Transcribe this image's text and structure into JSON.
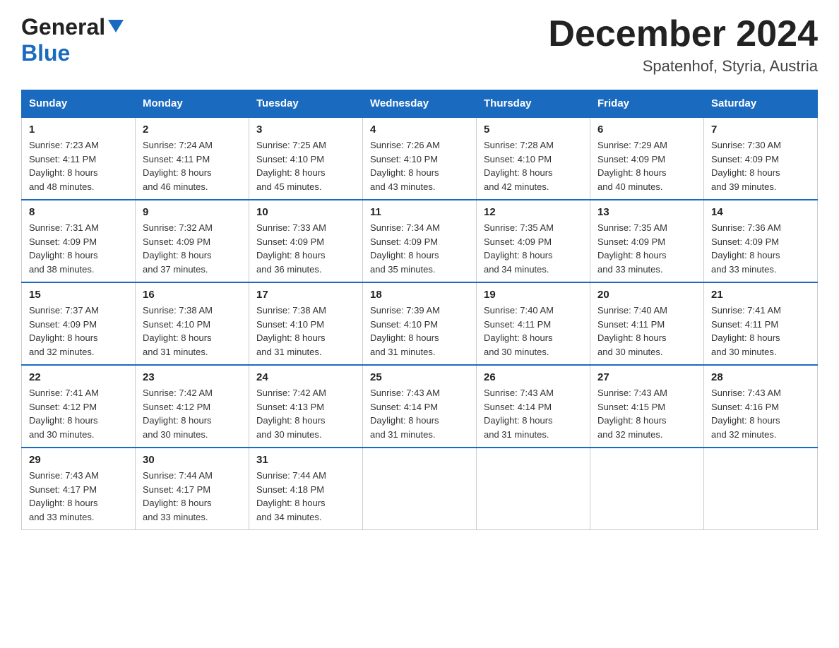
{
  "header": {
    "logo_general": "General",
    "logo_blue": "Blue",
    "month_year": "December 2024",
    "location": "Spatenhof, Styria, Austria"
  },
  "days_of_week": [
    "Sunday",
    "Monday",
    "Tuesday",
    "Wednesday",
    "Thursday",
    "Friday",
    "Saturday"
  ],
  "weeks": [
    [
      {
        "day": "1",
        "sunrise": "Sunrise: 7:23 AM",
        "sunset": "Sunset: 4:11 PM",
        "daylight": "Daylight: 8 hours",
        "daylight2": "and 48 minutes."
      },
      {
        "day": "2",
        "sunrise": "Sunrise: 7:24 AM",
        "sunset": "Sunset: 4:11 PM",
        "daylight": "Daylight: 8 hours",
        "daylight2": "and 46 minutes."
      },
      {
        "day": "3",
        "sunrise": "Sunrise: 7:25 AM",
        "sunset": "Sunset: 4:10 PM",
        "daylight": "Daylight: 8 hours",
        "daylight2": "and 45 minutes."
      },
      {
        "day": "4",
        "sunrise": "Sunrise: 7:26 AM",
        "sunset": "Sunset: 4:10 PM",
        "daylight": "Daylight: 8 hours",
        "daylight2": "and 43 minutes."
      },
      {
        "day": "5",
        "sunrise": "Sunrise: 7:28 AM",
        "sunset": "Sunset: 4:10 PM",
        "daylight": "Daylight: 8 hours",
        "daylight2": "and 42 minutes."
      },
      {
        "day": "6",
        "sunrise": "Sunrise: 7:29 AM",
        "sunset": "Sunset: 4:09 PM",
        "daylight": "Daylight: 8 hours",
        "daylight2": "and 40 minutes."
      },
      {
        "day": "7",
        "sunrise": "Sunrise: 7:30 AM",
        "sunset": "Sunset: 4:09 PM",
        "daylight": "Daylight: 8 hours",
        "daylight2": "and 39 minutes."
      }
    ],
    [
      {
        "day": "8",
        "sunrise": "Sunrise: 7:31 AM",
        "sunset": "Sunset: 4:09 PM",
        "daylight": "Daylight: 8 hours",
        "daylight2": "and 38 minutes."
      },
      {
        "day": "9",
        "sunrise": "Sunrise: 7:32 AM",
        "sunset": "Sunset: 4:09 PM",
        "daylight": "Daylight: 8 hours",
        "daylight2": "and 37 minutes."
      },
      {
        "day": "10",
        "sunrise": "Sunrise: 7:33 AM",
        "sunset": "Sunset: 4:09 PM",
        "daylight": "Daylight: 8 hours",
        "daylight2": "and 36 minutes."
      },
      {
        "day": "11",
        "sunrise": "Sunrise: 7:34 AM",
        "sunset": "Sunset: 4:09 PM",
        "daylight": "Daylight: 8 hours",
        "daylight2": "and 35 minutes."
      },
      {
        "day": "12",
        "sunrise": "Sunrise: 7:35 AM",
        "sunset": "Sunset: 4:09 PM",
        "daylight": "Daylight: 8 hours",
        "daylight2": "and 34 minutes."
      },
      {
        "day": "13",
        "sunrise": "Sunrise: 7:35 AM",
        "sunset": "Sunset: 4:09 PM",
        "daylight": "Daylight: 8 hours",
        "daylight2": "and 33 minutes."
      },
      {
        "day": "14",
        "sunrise": "Sunrise: 7:36 AM",
        "sunset": "Sunset: 4:09 PM",
        "daylight": "Daylight: 8 hours",
        "daylight2": "and 33 minutes."
      }
    ],
    [
      {
        "day": "15",
        "sunrise": "Sunrise: 7:37 AM",
        "sunset": "Sunset: 4:09 PM",
        "daylight": "Daylight: 8 hours",
        "daylight2": "and 32 minutes."
      },
      {
        "day": "16",
        "sunrise": "Sunrise: 7:38 AM",
        "sunset": "Sunset: 4:10 PM",
        "daylight": "Daylight: 8 hours",
        "daylight2": "and 31 minutes."
      },
      {
        "day": "17",
        "sunrise": "Sunrise: 7:38 AM",
        "sunset": "Sunset: 4:10 PM",
        "daylight": "Daylight: 8 hours",
        "daylight2": "and 31 minutes."
      },
      {
        "day": "18",
        "sunrise": "Sunrise: 7:39 AM",
        "sunset": "Sunset: 4:10 PM",
        "daylight": "Daylight: 8 hours",
        "daylight2": "and 31 minutes."
      },
      {
        "day": "19",
        "sunrise": "Sunrise: 7:40 AM",
        "sunset": "Sunset: 4:11 PM",
        "daylight": "Daylight: 8 hours",
        "daylight2": "and 30 minutes."
      },
      {
        "day": "20",
        "sunrise": "Sunrise: 7:40 AM",
        "sunset": "Sunset: 4:11 PM",
        "daylight": "Daylight: 8 hours",
        "daylight2": "and 30 minutes."
      },
      {
        "day": "21",
        "sunrise": "Sunrise: 7:41 AM",
        "sunset": "Sunset: 4:11 PM",
        "daylight": "Daylight: 8 hours",
        "daylight2": "and 30 minutes."
      }
    ],
    [
      {
        "day": "22",
        "sunrise": "Sunrise: 7:41 AM",
        "sunset": "Sunset: 4:12 PM",
        "daylight": "Daylight: 8 hours",
        "daylight2": "and 30 minutes."
      },
      {
        "day": "23",
        "sunrise": "Sunrise: 7:42 AM",
        "sunset": "Sunset: 4:12 PM",
        "daylight": "Daylight: 8 hours",
        "daylight2": "and 30 minutes."
      },
      {
        "day": "24",
        "sunrise": "Sunrise: 7:42 AM",
        "sunset": "Sunset: 4:13 PM",
        "daylight": "Daylight: 8 hours",
        "daylight2": "and 30 minutes."
      },
      {
        "day": "25",
        "sunrise": "Sunrise: 7:43 AM",
        "sunset": "Sunset: 4:14 PM",
        "daylight": "Daylight: 8 hours",
        "daylight2": "and 31 minutes."
      },
      {
        "day": "26",
        "sunrise": "Sunrise: 7:43 AM",
        "sunset": "Sunset: 4:14 PM",
        "daylight": "Daylight: 8 hours",
        "daylight2": "and 31 minutes."
      },
      {
        "day": "27",
        "sunrise": "Sunrise: 7:43 AM",
        "sunset": "Sunset: 4:15 PM",
        "daylight": "Daylight: 8 hours",
        "daylight2": "and 32 minutes."
      },
      {
        "day": "28",
        "sunrise": "Sunrise: 7:43 AM",
        "sunset": "Sunset: 4:16 PM",
        "daylight": "Daylight: 8 hours",
        "daylight2": "and 32 minutes."
      }
    ],
    [
      {
        "day": "29",
        "sunrise": "Sunrise: 7:43 AM",
        "sunset": "Sunset: 4:17 PM",
        "daylight": "Daylight: 8 hours",
        "daylight2": "and 33 minutes."
      },
      {
        "day": "30",
        "sunrise": "Sunrise: 7:44 AM",
        "sunset": "Sunset: 4:17 PM",
        "daylight": "Daylight: 8 hours",
        "daylight2": "and 33 minutes."
      },
      {
        "day": "31",
        "sunrise": "Sunrise: 7:44 AM",
        "sunset": "Sunset: 4:18 PM",
        "daylight": "Daylight: 8 hours",
        "daylight2": "and 34 minutes."
      },
      null,
      null,
      null,
      null
    ]
  ]
}
